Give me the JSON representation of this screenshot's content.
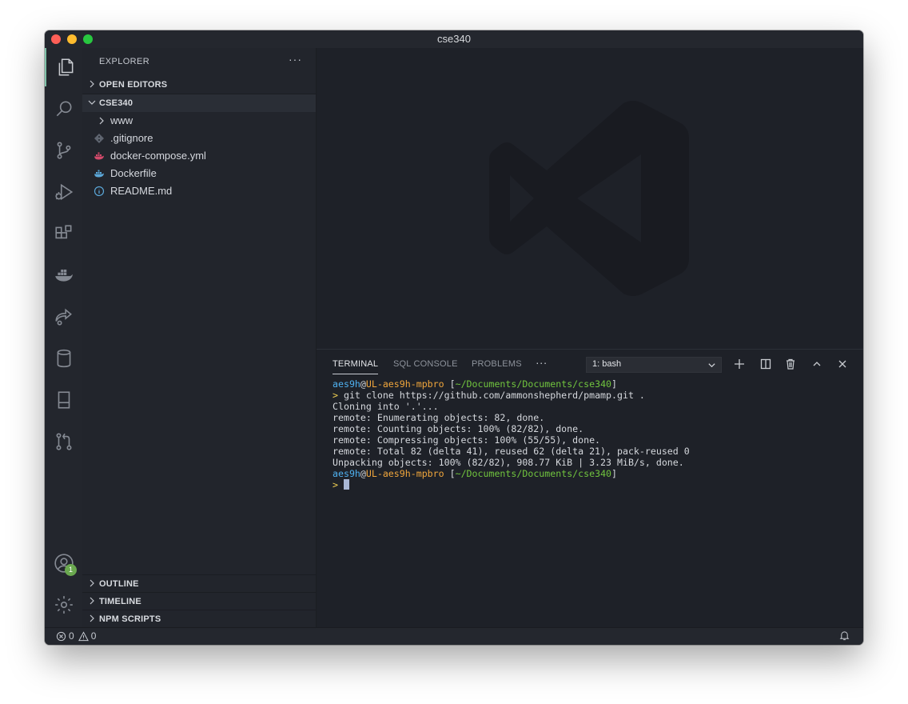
{
  "window": {
    "title": "cse340"
  },
  "activity_bar": {
    "items": [
      {
        "icon": "files-icon",
        "active": true
      },
      {
        "icon": "search-icon"
      },
      {
        "icon": "source-control-icon"
      },
      {
        "icon": "run-debug-icon"
      },
      {
        "icon": "extensions-icon"
      },
      {
        "icon": "docker-icon"
      },
      {
        "icon": "live-share-icon"
      },
      {
        "icon": "database-icon"
      },
      {
        "icon": "notebook-icon"
      },
      {
        "icon": "pull-request-icon"
      }
    ],
    "accounts_badge": "1"
  },
  "sidebar": {
    "header": "EXPLORER",
    "more": "···",
    "open_editors": "OPEN EDITORS",
    "folder": "CSE340",
    "files": [
      {
        "name": "www",
        "icon": "chevron-right-icon"
      },
      {
        "name": ".gitignore",
        "icon": "git-file-icon"
      },
      {
        "name": "docker-compose.yml",
        "icon": "docker-file-icon"
      },
      {
        "name": "Dockerfile",
        "icon": "docker-file-icon"
      },
      {
        "name": "README.md",
        "icon": "info-icon"
      }
    ],
    "outline": "OUTLINE",
    "timeline": "TIMELINE",
    "npm_scripts": "NPM SCRIPTS"
  },
  "panel": {
    "tabs": [
      "TERMINAL",
      "SQL CONSOLE",
      "PROBLEMS"
    ],
    "active_tab": "TERMINAL",
    "more": "···",
    "terminal_select": "1: bash"
  },
  "terminal": {
    "user": "aes9h",
    "at": "@",
    "host": "UL-aes9h-mpbro",
    "path": "~/Documents/Documents/cse340",
    "prompt": ">",
    "command": " git clone https://github.com/ammonshepherd/pmamp.git .",
    "output": [
      "Cloning into '.'...",
      "remote: Enumerating objects: 82, done.",
      "remote: Counting objects: 100% (82/82), done.",
      "remote: Compressing objects: 100% (55/55), done.",
      "remote: Total 82 (delta 41), reused 62 (delta 21), pack-reused 0",
      "Unpacking objects: 100% (82/82), 908.77 KiB | 3.23 MiB/s, done."
    ]
  },
  "statusbar": {
    "errors": "0",
    "warnings": "0"
  },
  "colors": {
    "background": "#1e2128",
    "sidebar": "#22252c",
    "accent": "#7fc2a8",
    "user": "#4fb1f0",
    "host": "#f0a63c",
    "path": "#71c43e",
    "prompt": "#f1d052"
  }
}
